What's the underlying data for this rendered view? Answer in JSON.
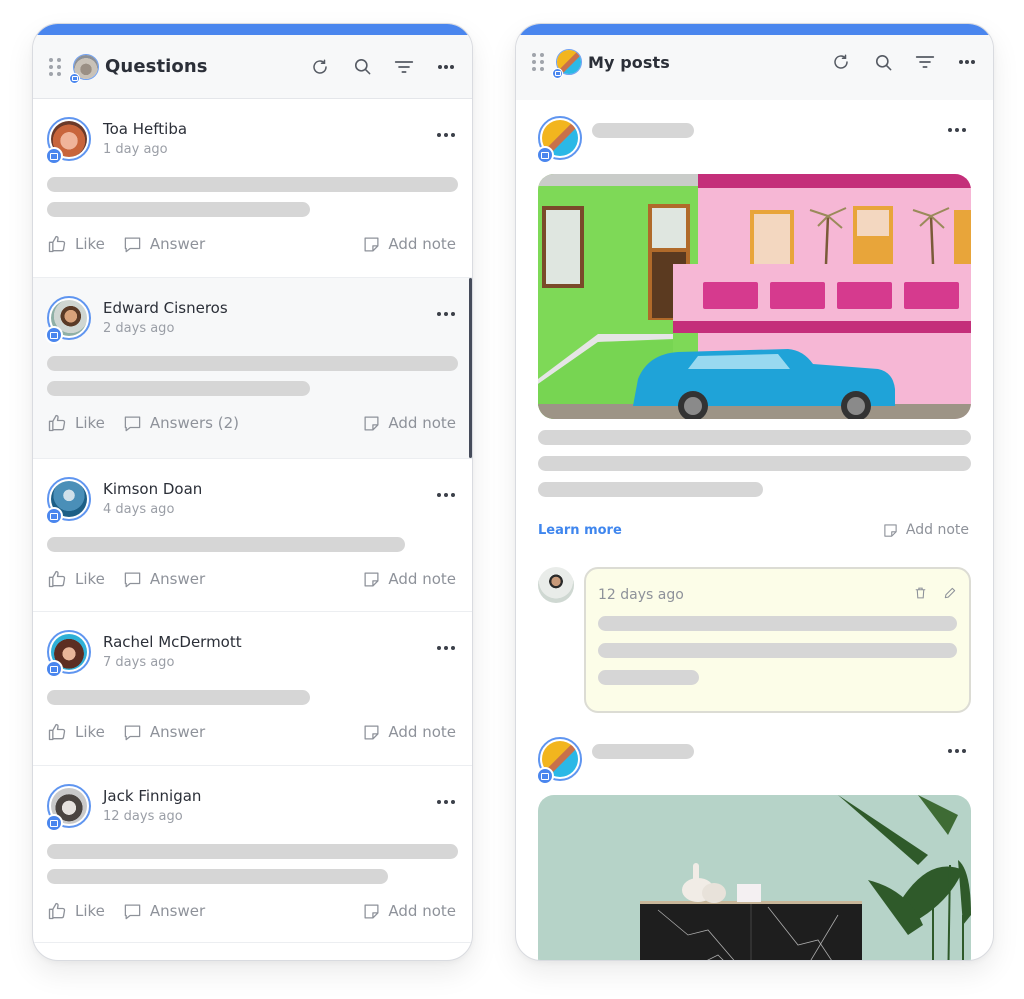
{
  "questions_panel": {
    "title": "Questions",
    "header_icons": [
      "refresh-icon",
      "search-icon",
      "filter-icon",
      "more-icon"
    ],
    "items": [
      {
        "name": "Toa Heftiba",
        "time": "1 day ago",
        "actions": {
          "like": "Like",
          "answer": "Answer",
          "note": "Add note"
        }
      },
      {
        "name": "Edward Cisneros",
        "time": "2 days ago",
        "actions": {
          "like": "Like",
          "answer": "Answers (2)",
          "note": "Add note"
        }
      },
      {
        "name": "Kimson Doan",
        "time": "4 days ago",
        "actions": {
          "like": "Like",
          "answer": "Answer",
          "note": "Add note"
        }
      },
      {
        "name": "Rachel McDermott",
        "time": "7 days ago",
        "actions": {
          "like": "Like",
          "answer": "Answer",
          "note": "Add note"
        }
      },
      {
        "name": "Jack Finnigan",
        "time": "12 days ago",
        "actions": {
          "like": "Like",
          "answer": "Answer",
          "note": "Add note"
        }
      }
    ]
  },
  "posts_panel": {
    "title": "My posts",
    "header_icons": [
      "refresh-icon",
      "search-icon",
      "filter-icon",
      "more-icon"
    ],
    "posts": [
      {
        "image": "colorful houses with blue vintage car",
        "learn_more": "Learn more",
        "add_note": "Add note",
        "note": {
          "time": "12 days ago",
          "icons": [
            "trash-icon",
            "pencil-icon"
          ]
        }
      },
      {
        "image": "marble cabinet with plant on mint wall"
      }
    ]
  },
  "colors": {
    "accent": "#4a86ee",
    "link": "#3f86ee",
    "skeleton": "#d6d6d6",
    "note_bg": "#fcfde8"
  }
}
